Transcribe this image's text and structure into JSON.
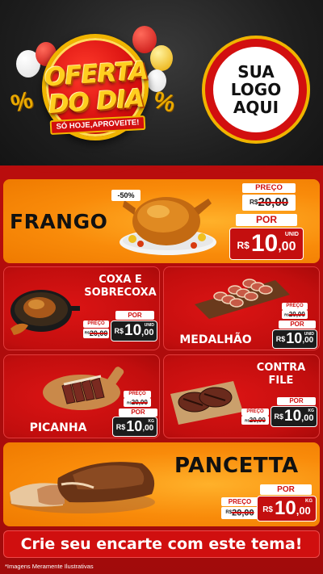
{
  "header": {
    "badge_line1": "OFERTA",
    "badge_line2": "DO DIA",
    "badge_sub": "SÓ HOJE,APROVEITE!",
    "percent_symbol": "%",
    "logo_line1": "SUA",
    "logo_line2": "LOGO",
    "logo_line3": "AQUI"
  },
  "labels": {
    "preco": "PREÇO",
    "por": "POR",
    "currency": "R$"
  },
  "products": {
    "frango": {
      "name": "FRANGO",
      "discount": "-50%",
      "old_price": "20,00",
      "new_price_int": "10",
      "new_price_dec": ",00",
      "unit": "UNID"
    },
    "coxa": {
      "name_line1": "COXA E",
      "name_line2": "SOBRECOXA",
      "old_price": "20,00",
      "new_price_int": "10",
      "new_price_dec": ",00",
      "unit": "UNID"
    },
    "medalhao": {
      "name": "MEDALHÃO",
      "old_price": "20,00",
      "new_price_int": "10",
      "new_price_dec": ",00",
      "unit": "UNID"
    },
    "picanha": {
      "name": "PICANHA",
      "old_price": "20,00",
      "new_price_int": "10",
      "new_price_dec": ",00",
      "unit": "KG"
    },
    "contrafile": {
      "name_line1": "CONTRA",
      "name_line2": "FILE",
      "old_price": "20,00",
      "new_price_int": "10",
      "new_price_dec": ",00",
      "unit": "KG"
    },
    "pancetta": {
      "name": "PANCETTA",
      "old_price": "20,00",
      "new_price_int": "10",
      "new_price_dec": ",00",
      "unit": "KG"
    }
  },
  "cta": "Crie seu encarte com este tema!",
  "footnote": "*Imagens Meramente Ilustrativas",
  "colors": {
    "red": "#c40f0f",
    "orange": "#f98b0a",
    "gold": "#f0b400",
    "dark_background": "#1e1e1e"
  }
}
